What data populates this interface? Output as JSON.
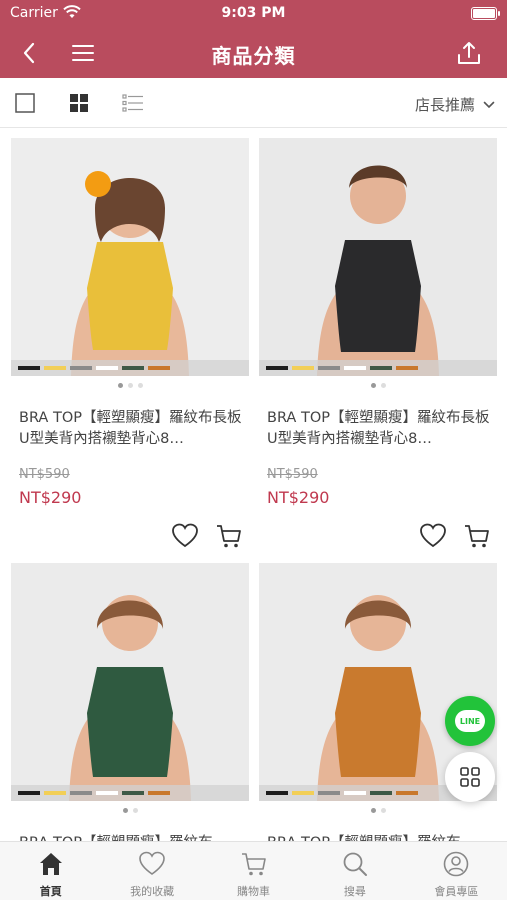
{
  "status": {
    "carrier": "Carrier",
    "time": "9:03 PM"
  },
  "nav": {
    "title": "商品分類"
  },
  "toolbar": {
    "sort_label": "店長推薦"
  },
  "products": [
    {
      "name": "BRA TOP【輕塑顯瘦】羅紋布長板U型美背內搭襯墊背心8…",
      "original_price": "NT$590",
      "price": "NT$290",
      "color": "yellow"
    },
    {
      "name": "BRA TOP【輕塑顯瘦】羅紋布長板U型美背內搭襯墊背心8…",
      "original_price": "NT$590",
      "price": "NT$290",
      "color": "black"
    },
    {
      "name": "BRA TOP【輕塑顯瘦】羅紋布",
      "original_price": "",
      "price": "",
      "color": "green"
    },
    {
      "name": "BRA TOP【輕塑顯瘦】羅紋布",
      "original_price": "",
      "price": "",
      "color": "orange"
    }
  ],
  "swatch_colors": [
    "#1e1e1e",
    "#f2cf57",
    "#8a8a8a",
    "#ffffff",
    "#3e5a47",
    "#c9782c"
  ],
  "garment_colors": {
    "yellow": "#e9bf3a",
    "black": "#2a2a2c",
    "green": "#2f5a40",
    "orange": "#c97a2e"
  },
  "floating": {
    "line_label": "LINE"
  },
  "tabs": [
    {
      "label": "首頁",
      "icon": "home-icon",
      "active": true
    },
    {
      "label": "我的收藏",
      "icon": "heart-icon",
      "active": false
    },
    {
      "label": "購物車",
      "icon": "cart-icon",
      "active": false
    },
    {
      "label": "搜尋",
      "icon": "search-icon",
      "active": false
    },
    {
      "label": "會員專區",
      "icon": "user-icon",
      "active": false
    }
  ],
  "colors": {
    "brand": "#b94c5e",
    "price": "#c0394f",
    "line": "#22c33a"
  }
}
